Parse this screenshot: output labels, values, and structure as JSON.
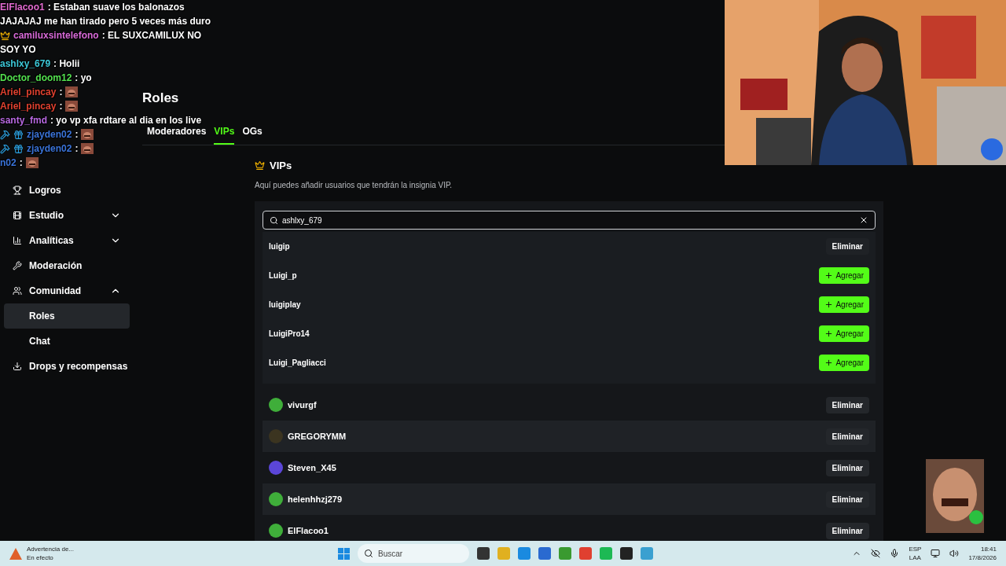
{
  "chat": [
    {
      "name": "ElFlacoo1",
      "color": "#e26bd0",
      "text": ": Estaban suave los balonazos",
      "kind": "plain"
    },
    {
      "text": "JAJAJAJ me han tirado pero 5 veces más duro",
      "kind": "plain"
    },
    {
      "name": "camiluxsintelefono",
      "color": "#d86ad8",
      "text": ": EL SUXCAMILUX NO",
      "kind": "vip"
    },
    {
      "text": "SOY YO",
      "kind": "plain"
    },
    {
      "name": "ashlxy_679",
      "color": "#3cc8d8",
      "text": ": Holii",
      "kind": "plain"
    },
    {
      "name": "Doctor_doom12",
      "color": "#53e04f",
      "text": ": yo",
      "kind": "plain"
    },
    {
      "name": "Ariel_pincay",
      "color": "#e0412f",
      "text": ":",
      "kind": "plain",
      "emote": true
    },
    {
      "name": "Ariel_pincay",
      "color": "#e0412f",
      "text": ":",
      "kind": "plain",
      "emote": true
    },
    {
      "name": "santy_fmd",
      "color": "#b768e0",
      "text": ": yo vp xfa rdtare al dia en los live",
      "kind": "plain"
    },
    {
      "name": "zjayden02",
      "color": "#3a73d8",
      "text": ":",
      "kind": "mod",
      "emote": true
    },
    {
      "name": "zjayden02",
      "color": "#3a73d8",
      "text": ":",
      "kind": "mod",
      "emote": true
    },
    {
      "name": "n02",
      "color": "#3a73d8",
      "text": ":",
      "kind": "plain",
      "emote": true
    }
  ],
  "sidebar": [
    {
      "label": "Logros"
    },
    {
      "label": "Estudio",
      "expanded": false
    },
    {
      "label": "Analíticas",
      "expanded": false
    },
    {
      "label": "Moderación"
    },
    {
      "label": "Comunidad",
      "expanded": true,
      "children": [
        {
          "label": "Roles",
          "selected": true
        },
        {
          "label": "Chat",
          "selected": false
        }
      ]
    },
    {
      "label": "Drops y recompensas"
    }
  ],
  "page_title": "Roles",
  "tabs": [
    {
      "label": "Moderadores",
      "selected": false
    },
    {
      "label": "VIPs",
      "selected": true
    },
    {
      "label": "OGs",
      "selected": false
    }
  ],
  "section": {
    "title": "VIPs",
    "description": "Aquí puedes añadir usuarios que tendrán la insignia VIP."
  },
  "search": {
    "value": "ashlxy_679"
  },
  "results": [
    {
      "name": "luigip",
      "kind": "remove",
      "action": "Eliminar"
    },
    {
      "name": "Luigi_p",
      "kind": "add",
      "action": "Agregar"
    },
    {
      "name": "luigiplay",
      "kind": "add",
      "action": "Agregar"
    },
    {
      "name": "LuigiPro14",
      "kind": "add",
      "action": "Agregar"
    },
    {
      "name": "Luigi_Pagliacci",
      "kind": "add",
      "action": "Agregar"
    }
  ],
  "vips": [
    {
      "name": "vivurgf",
      "color": "#3fae3a",
      "action": "Eliminar"
    },
    {
      "name": "GREGORYMM",
      "color": "#3b3420",
      "action": "Eliminar"
    },
    {
      "name": "Steven_X45",
      "color": "#5b46d8",
      "action": "Eliminar"
    },
    {
      "name": "helenhhzj279",
      "color": "#3fae3a",
      "action": "Eliminar"
    },
    {
      "name": "ElFlacoo1",
      "color": "#3fae3a",
      "action": "Eliminar"
    }
  ],
  "taskbar": {
    "weather_title": "Advertencia de...",
    "weather_sub": "En efecto",
    "search": "Buscar",
    "lang": "ESP",
    "layout": "LAA",
    "time": "18:41",
    "date": "17/8/2026"
  }
}
